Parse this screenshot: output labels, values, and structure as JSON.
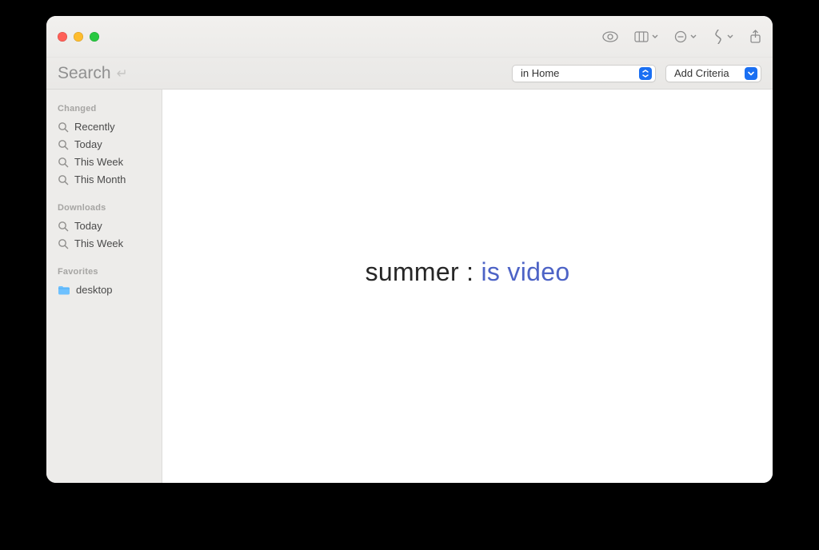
{
  "window": {
    "title": "Search"
  },
  "toolbar": {
    "scope_label": "in Home",
    "criteria_label": "Add Criteria"
  },
  "sidebar": {
    "sections": [
      {
        "title": "Changed",
        "items": [
          "Recently",
          "Today",
          "This Week",
          "This Month"
        ],
        "icon": "search"
      },
      {
        "title": "Downloads",
        "items": [
          "Today",
          "This Week"
        ],
        "icon": "search"
      },
      {
        "title": "Favorites",
        "items": [
          "desktop"
        ],
        "icon": "folder"
      }
    ]
  },
  "query": {
    "text": "summer : ",
    "filter": "is video"
  }
}
